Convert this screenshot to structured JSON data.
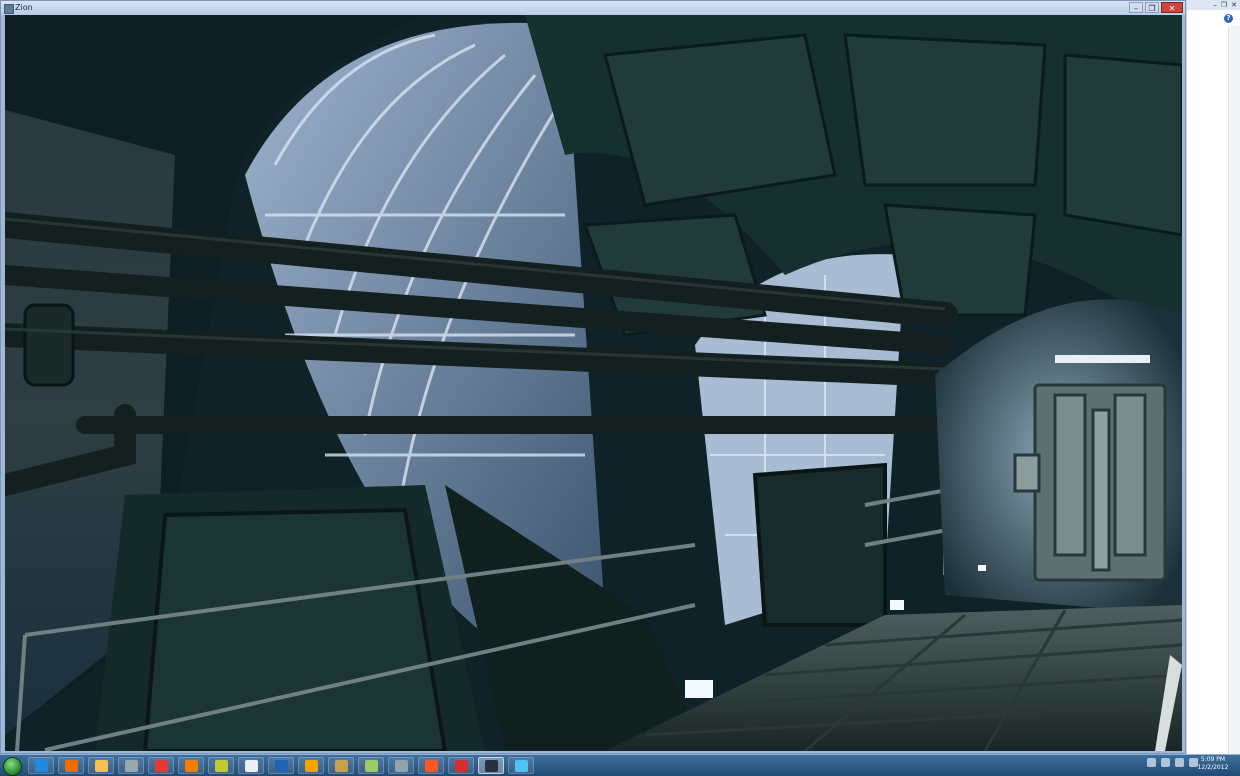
{
  "game_window": {
    "title": "Zion"
  },
  "background_app": {
    "help_label": "?",
    "controls": [
      "–",
      "❐",
      "✕"
    ]
  },
  "window_controls": {
    "minimize": "–",
    "maximize": "❐",
    "close": "✕"
  },
  "taskbar": {
    "items": [
      {
        "icon": "internet-explorer-icon",
        "color": "#1e88e5"
      },
      {
        "icon": "media-player-icon",
        "color": "#ef6c00"
      },
      {
        "icon": "folder-icon",
        "color": "#f2c14e"
      },
      {
        "icon": "settings-icon",
        "color": "#9aa6b2"
      },
      {
        "icon": "chrome-icon",
        "color": "#e53935"
      },
      {
        "icon": "firefox-icon",
        "color": "#f57c00"
      },
      {
        "icon": "calendar-icon",
        "color": "#c0ca33"
      },
      {
        "icon": "eye-icon",
        "color": "#eceff1"
      },
      {
        "icon": "word-icon",
        "color": "#1e63b8"
      },
      {
        "icon": "outlook-icon",
        "color": "#f4a300"
      },
      {
        "icon": "archive-icon",
        "color": "#c7a24b"
      },
      {
        "icon": "paint-icon",
        "color": "#9ccc65"
      },
      {
        "icon": "user-icon",
        "color": "#90a4ae"
      },
      {
        "icon": "game-icon",
        "color": "#ff5722"
      },
      {
        "icon": "mcafee-icon",
        "color": "#d32f2f"
      },
      {
        "icon": "zion-app-icon",
        "color": "#26323f"
      },
      {
        "icon": "photo-icon",
        "color": "#4fc3f7"
      }
    ],
    "clock_time": "5:09 PM",
    "clock_date": "12/2/2012"
  }
}
